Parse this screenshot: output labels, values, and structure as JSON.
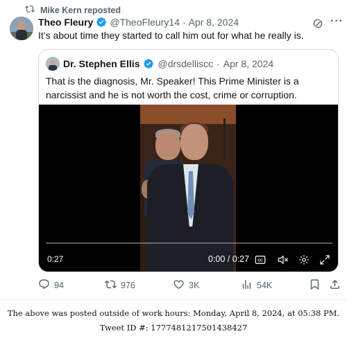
{
  "repost": {
    "label": "Mike Kern reposted"
  },
  "tweet": {
    "author_name": "Theo Fleury",
    "handle": "@TheoFleury14",
    "separator": "·",
    "date": "Apr 8, 2024",
    "text": "It’s about time they started to call him out for what he really is."
  },
  "quote": {
    "author_name": "Dr. Stephen Ellis",
    "handle": "@drsdelliscc",
    "separator": "·",
    "date": "Apr 8, 2024",
    "text": "That is the diagnosis, Mr. Speaker! This Prime Minister is a narcissist and he is not worth the cost, crime or corruption."
  },
  "video": {
    "time_left": "0:27",
    "time_display": "0:00 / 0:27",
    "progress": 0
  },
  "actions": {
    "replies": "94",
    "reposts": "976",
    "likes": "3K",
    "views": "54K"
  },
  "footer": {
    "note": "The above was posted outside of work hours: Monday, April 8, 2024, at 05:38 PM.",
    "tweet_id": "Tweet ID #: 1777481217501438427"
  },
  "colors": {
    "verified": "#1d9bf0",
    "muted": "#536471",
    "border": "#cfd9de"
  }
}
